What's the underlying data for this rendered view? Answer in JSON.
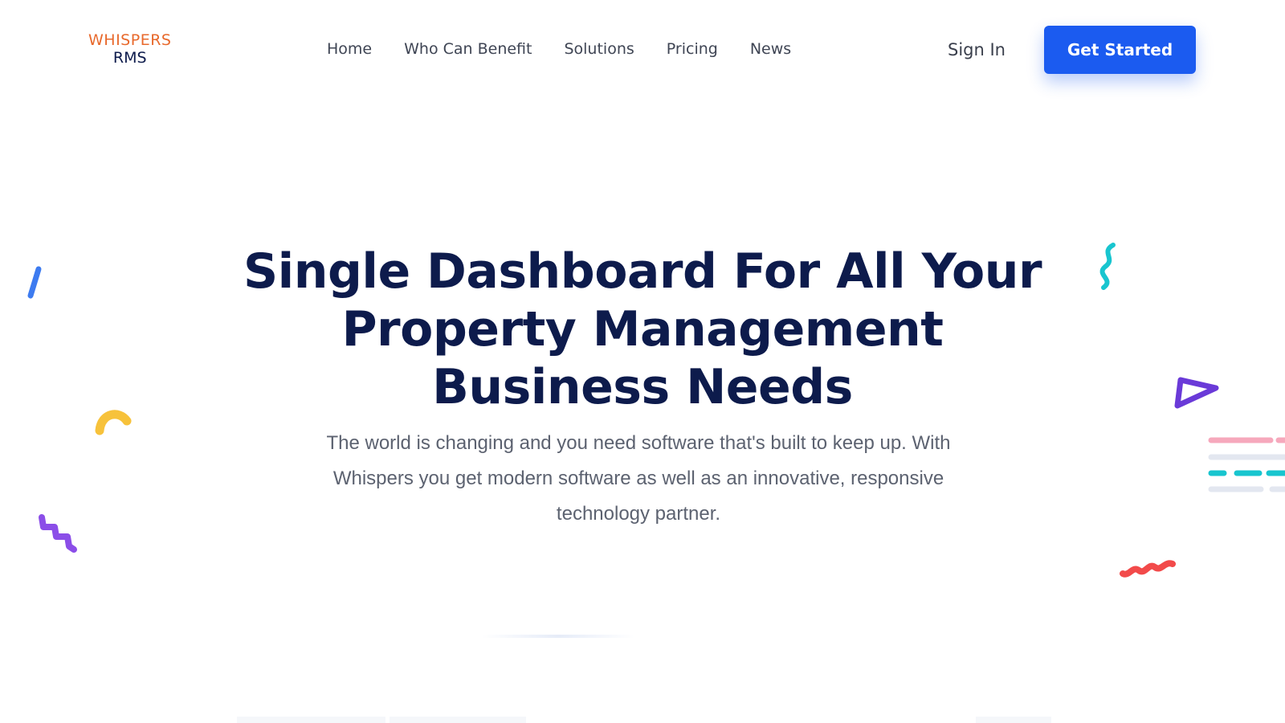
{
  "brand": {
    "logo_line1": "WHISPERS",
    "logo_line2": "RMS"
  },
  "nav": {
    "items": [
      {
        "label": "Home"
      },
      {
        "label": "Who Can Benefit"
      },
      {
        "label": "Solutions"
      },
      {
        "label": "Pricing"
      },
      {
        "label": "News"
      }
    ],
    "signin_label": "Sign In",
    "cta_label": "Get Started"
  },
  "hero": {
    "title_lines": [
      "Single Dashboard For All Your",
      "Property Management",
      "Business Needs"
    ],
    "subtitle": "The world is changing and you need software that's built to keep up. With Whispers you get modern software as well as an innovative, responsive technology partner."
  },
  "decorations": {
    "icons": [
      "blue-slash-icon",
      "yellow-arc-icon",
      "purple-zigzag-icon",
      "teal-squiggle-icon",
      "purple-triangle-icon",
      "red-zigzag-icon",
      "dashed-lines-icon"
    ]
  },
  "colors": {
    "accent": "#1b5bf0",
    "brand_orange": "#e8692c",
    "heading": "#0d1b4c",
    "body_text": "#5c6270",
    "deco_blue": "#3d7bf0",
    "deco_yellow": "#f7c23b",
    "deco_purple": "#8b4ee8",
    "deco_teal": "#18c5cf",
    "deco_violet": "#6a3ad8",
    "deco_red": "#f24a4a",
    "deco_pink": "#f6a8bc"
  }
}
